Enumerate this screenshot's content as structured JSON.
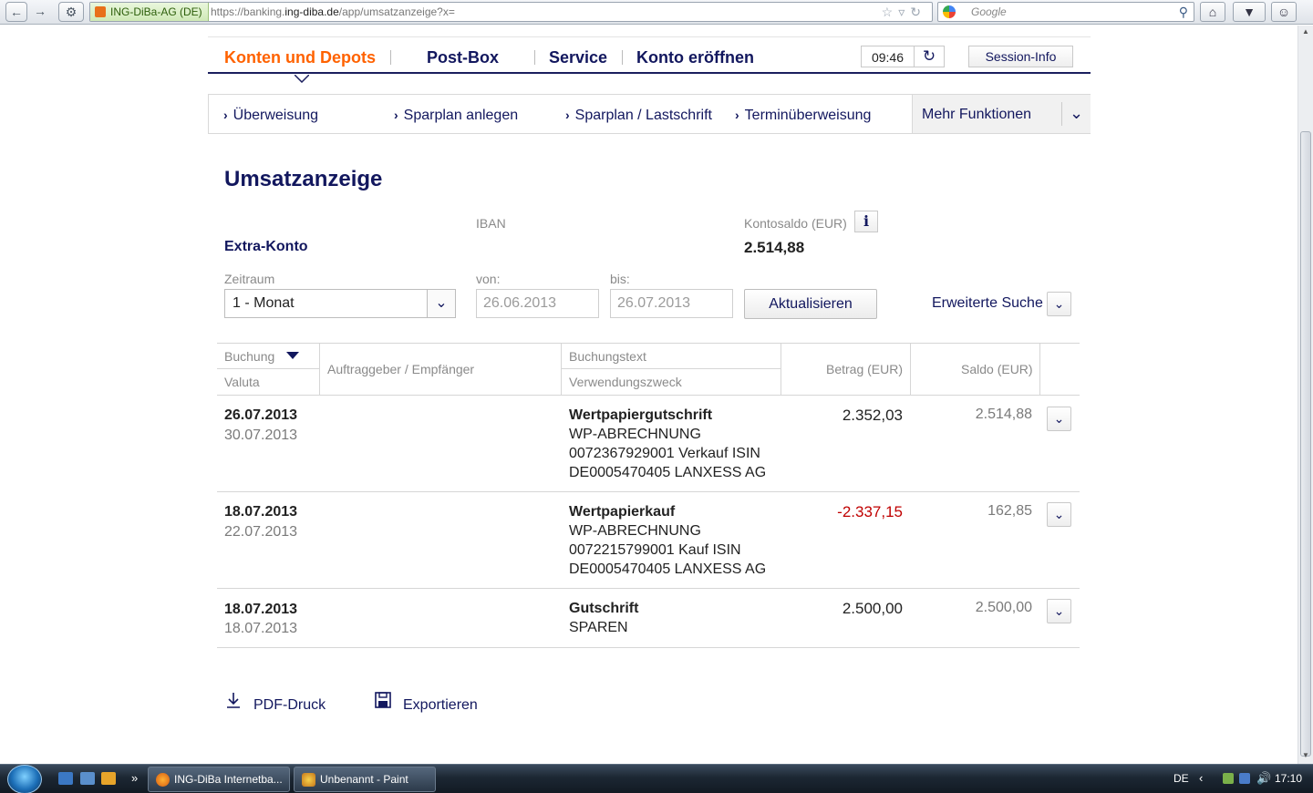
{
  "browser": {
    "back_icon": "arrow-left-icon",
    "site_identity": "ING-DiBa-AG (DE)",
    "url_prefix": "https://banking.",
    "url_domain": "ing-diba.de",
    "url_path": "/app/umsatzanzeige?x=",
    "search_placeholder": "Google"
  },
  "topnav": {
    "items": [
      {
        "label": "Konten und Depots",
        "active": true
      },
      {
        "label": "Post-Box"
      },
      {
        "label": "Service"
      },
      {
        "label": "Konto eröffnen"
      }
    ],
    "session_time": "09:46",
    "session_info_label": "Session-Info"
  },
  "subnav": {
    "items": [
      "Überweisung",
      "Sparplan anlegen",
      "Sparplan / Lastschrift",
      "Terminüberweisung"
    ],
    "more_label": "Mehr Funktionen"
  },
  "page": {
    "title": "Umsatzanzeige",
    "iban_label": "IBAN",
    "balance_label": "Kontosaldo (EUR)",
    "account_name": "Extra-Konto",
    "balance": "2.514,88"
  },
  "filter": {
    "period_label": "Zeitraum",
    "period_value": "1 - Monat",
    "from_label": "von:",
    "from_value": "26.06.2013",
    "to_label": "bis:",
    "to_value": "26.07.2013",
    "update_label": "Aktualisieren",
    "advanced_label": "Erweiterte Suche"
  },
  "table": {
    "headers": {
      "booking": "Buchung",
      "valuta": "Valuta",
      "party": "Auftraggeber / Empfänger",
      "booking_text": "Buchungstext",
      "purpose": "Verwendungszweck",
      "amount": "Betrag (EUR)",
      "saldo": "Saldo (EUR)"
    },
    "rows": [
      {
        "booking_date": "26.07.2013",
        "value_date": "30.07.2013",
        "party": "",
        "text": "Wertpapiergutschrift",
        "purpose": [
          "WP-ABRECHNUNG",
          "0072367929001 Verkauf ISIN",
          "DE0005470405 LANXESS AG"
        ],
        "amount": "2.352,03",
        "negative": false,
        "saldo": "2.514,88"
      },
      {
        "booking_date": "18.07.2013",
        "value_date": "22.07.2013",
        "party": "",
        "text": "Wertpapierkauf",
        "purpose": [
          "WP-ABRECHNUNG",
          "0072215799001 Kauf ISIN",
          "DE0005470405 LANXESS AG"
        ],
        "amount": "-2.337,15",
        "negative": true,
        "saldo": "162,85"
      },
      {
        "booking_date": "18.07.2013",
        "value_date": "18.07.2013",
        "party": "",
        "text": "Gutschrift",
        "purpose": [
          "SPAREN"
        ],
        "amount": "2.500,00",
        "negative": false,
        "saldo": "2.500,00"
      }
    ]
  },
  "actions": {
    "pdf_label": "PDF-Druck",
    "export_label": "Exportieren"
  },
  "taskbar": {
    "tasks": [
      "ING-DiBa Internetba...",
      "Unbenannt - Paint"
    ],
    "language": "DE",
    "time": "17:10"
  },
  "colors": {
    "brand_orange": "#ff6200",
    "brand_navy": "#12175e",
    "negative_red": "#c00000"
  }
}
